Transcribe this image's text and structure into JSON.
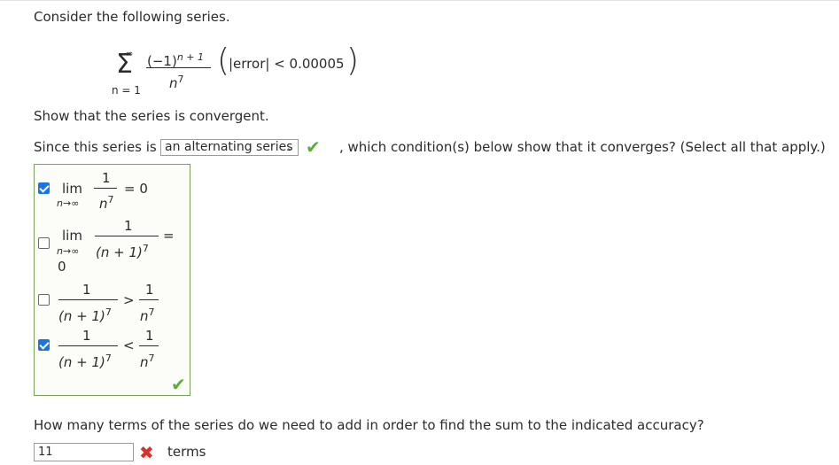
{
  "problem": {
    "intro": "Consider the following series.",
    "series": {
      "sum_upper": "∞",
      "sum_lower": "n = 1",
      "numerator_base": "(−1)",
      "numerator_exp": "n + 1",
      "denominator_base": "n",
      "denominator_exp": "7",
      "accuracy": "|error| < 0.00005"
    },
    "task": "Show that the series is convergent.",
    "since_prefix": "Since this series is",
    "series_type_selected": "an alternating series",
    "since_suffix": ", which condition(s) below show that it converges? (Select all that apply.)"
  },
  "options": [
    {
      "checked": true,
      "lim": "lim",
      "sub": "n→∞",
      "num": "1",
      "den": "n",
      "den_exp": "7",
      "rel": "= 0"
    },
    {
      "checked": false,
      "lim": "lim",
      "sub": "n→∞",
      "num": "1",
      "den": "(n + 1)",
      "den_exp": "7",
      "rel": "=",
      "trail": "0"
    },
    {
      "checked": false,
      "lnum": "1",
      "lden": "(n + 1)",
      "lden_exp": "7",
      "rel": ">",
      "rnum": "1",
      "rden": "n",
      "rden_exp": "7"
    },
    {
      "checked": true,
      "lnum": "1",
      "lden": "(n + 1)",
      "lden_exp": "7",
      "rel": "<",
      "rnum": "1",
      "rden": "n",
      "rden_exp": "7"
    }
  ],
  "question2": {
    "text": "How many terms of the series do we need to add in order to find the sum to the indicated accuracy?",
    "answer_value": "11",
    "unit": "terms"
  },
  "icons": {
    "correct": "check-icon",
    "incorrect": "x-icon",
    "correct_color": "#5aad36",
    "incorrect_color": "#d9302b",
    "checkbox_color": "#1a73e8"
  }
}
